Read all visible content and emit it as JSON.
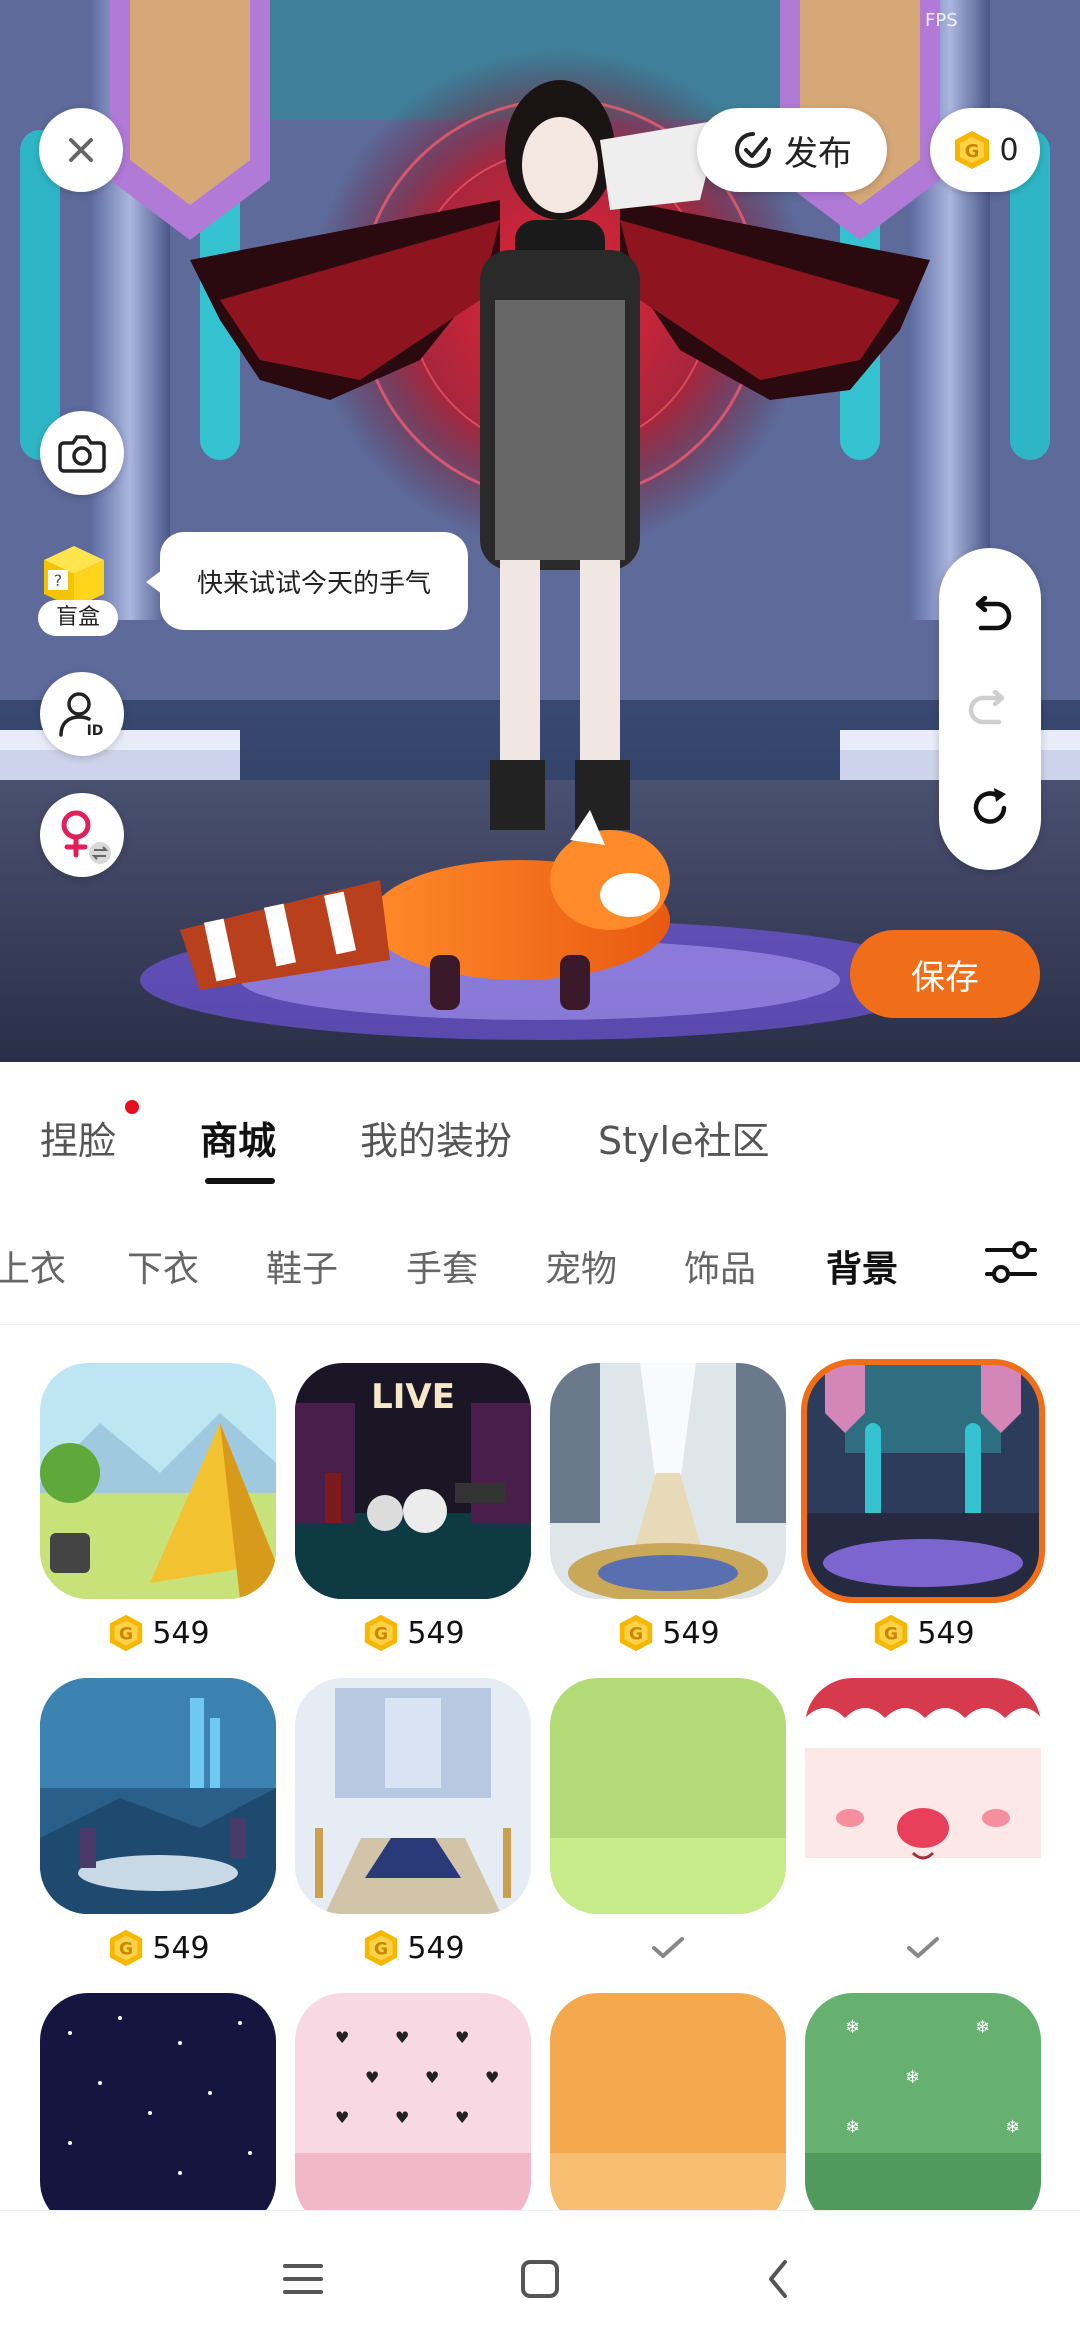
{
  "status": {
    "fps_label": "FPS"
  },
  "toolbar": {
    "publish_label": "发布",
    "coin_count": "0"
  },
  "side_tools": {
    "blindbox_label": "盲盒",
    "tooltip_text": "快来试试今天的手气"
  },
  "actions": {
    "save_label": "保存"
  },
  "main_tabs": [
    {
      "label": "捏脸",
      "has_dot": true
    },
    {
      "label": "商城",
      "active": true
    },
    {
      "label": "我的装扮"
    },
    {
      "label": "Style社区"
    }
  ],
  "sub_tabs": [
    {
      "label": "上衣"
    },
    {
      "label": "下衣"
    },
    {
      "label": "鞋子"
    },
    {
      "label": "手套"
    },
    {
      "label": "宠物"
    },
    {
      "label": "饰品"
    },
    {
      "label": "背景",
      "active": true
    }
  ],
  "items": [
    {
      "name": "tent-meadow",
      "price": "549"
    },
    {
      "name": "live-stage",
      "price": "549"
    },
    {
      "name": "cathedral-hall",
      "price": "549"
    },
    {
      "name": "gothic-castle",
      "price": "549",
      "selected": true
    },
    {
      "name": "crystal-ruins",
      "price": "549"
    },
    {
      "name": "royal-palace",
      "price": "549"
    },
    {
      "name": "green-solid",
      "owned": true
    },
    {
      "name": "santa-face",
      "owned": true
    },
    {
      "name": "starry-night"
    },
    {
      "name": "pink-hearts"
    },
    {
      "name": "orange-solid"
    },
    {
      "name": "green-snowflake"
    }
  ],
  "colors": {
    "accent": "#f06e1a",
    "coin": "#f5b700",
    "notification_dot": "#e5101e"
  }
}
